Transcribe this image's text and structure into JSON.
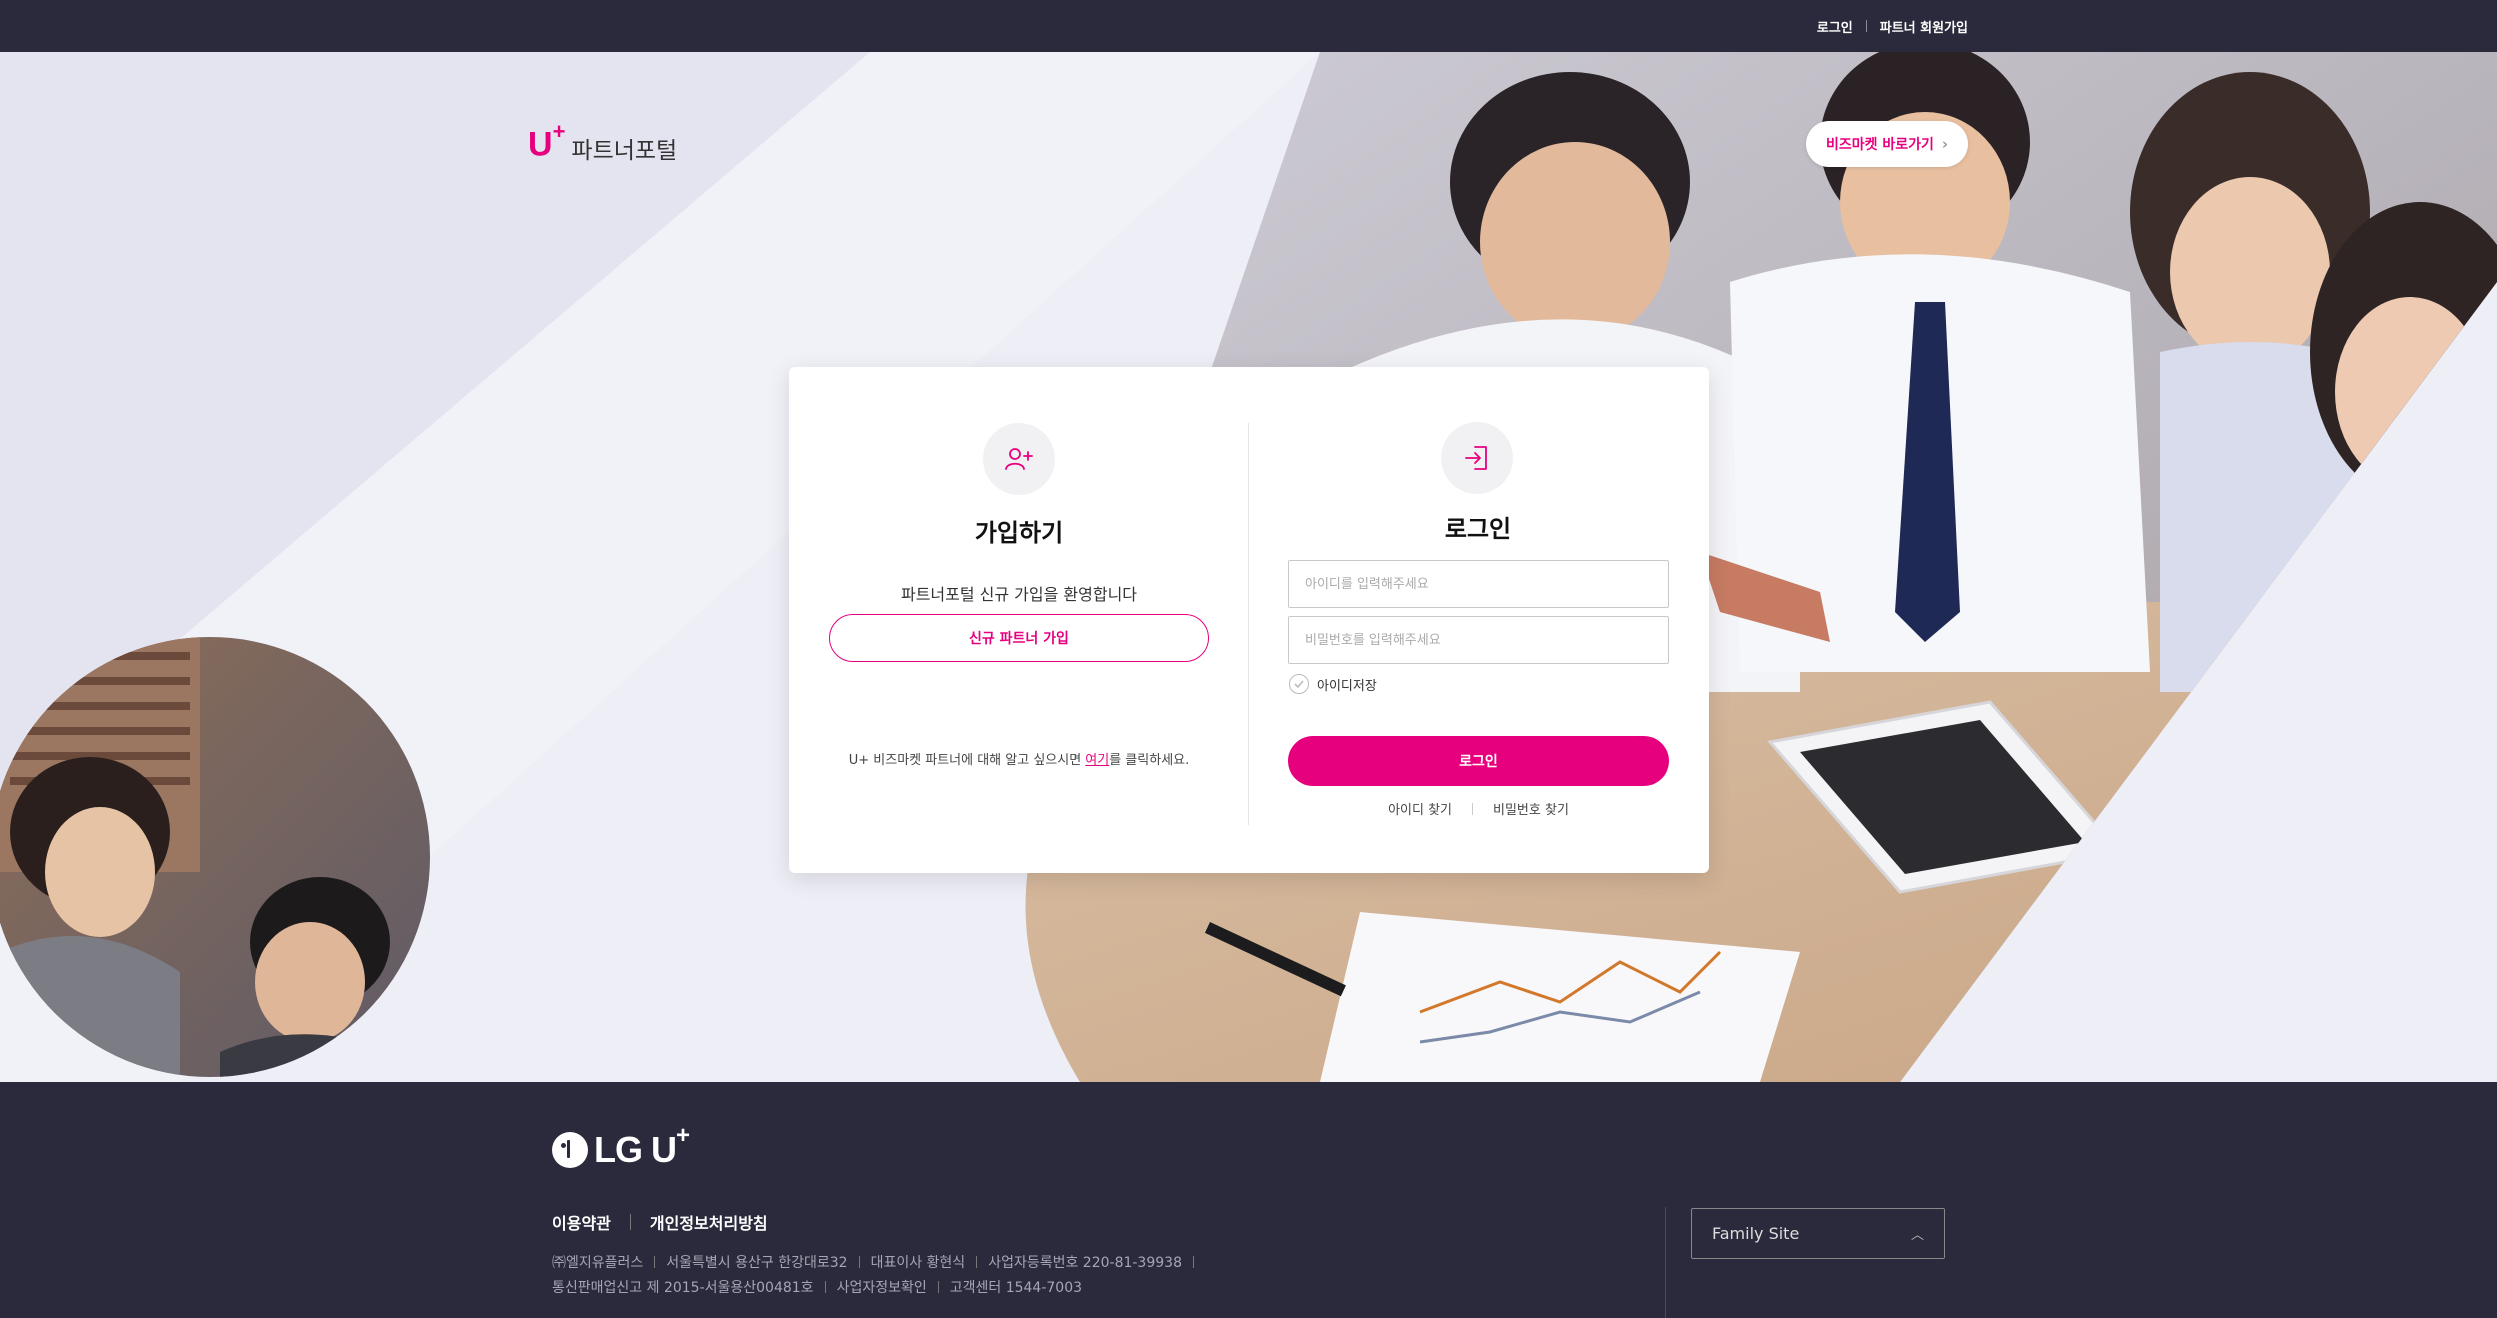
{
  "topbar": {
    "login_link": "로그인",
    "signup_link": "파트너 회원가입"
  },
  "header": {
    "logo_mark": "U",
    "logo_plus": "+",
    "logo_name": "파트너포털",
    "biz_market_button": "비즈마켓 바로가기"
  },
  "join": {
    "title": "가입하기",
    "welcome": "파트너포털 신규 가입을 환영합니다",
    "button": "신규 파트너 가입",
    "info_before": "U+ 비즈마켓 파트너에 대해 알고 싶으시면 ",
    "info_link": "여기",
    "info_after": "를 클릭하세요."
  },
  "login": {
    "title": "로그인",
    "id_placeholder": "아이디를 입력해주세요",
    "pw_placeholder": "비밀번호를 입력해주세요",
    "save_id_label": "아이디저장",
    "button": "로그인",
    "find_id": "아이디 찾기",
    "find_pw": "비밀번호 찾기"
  },
  "footer": {
    "brand_text": "LG U",
    "brand_plus": "+",
    "terms": "이용약관",
    "privacy": "개인정보처리방침",
    "info_line1": [
      "㈜엘지유플러스",
      "서울특별시 용산구 한강대로32",
      "대표이사 황현식",
      "사업자등록번호 220-81-39938"
    ],
    "info_line2": [
      "통신판매업신고 제 2015-서울용산00481호",
      "사업자정보확인",
      "고객센터 1544-7003"
    ],
    "family_site": "Family Site"
  },
  "colors": {
    "accent": "#e6007e",
    "dark_bg": "#2a2a3c",
    "hero_bg": "#eeeef6"
  }
}
